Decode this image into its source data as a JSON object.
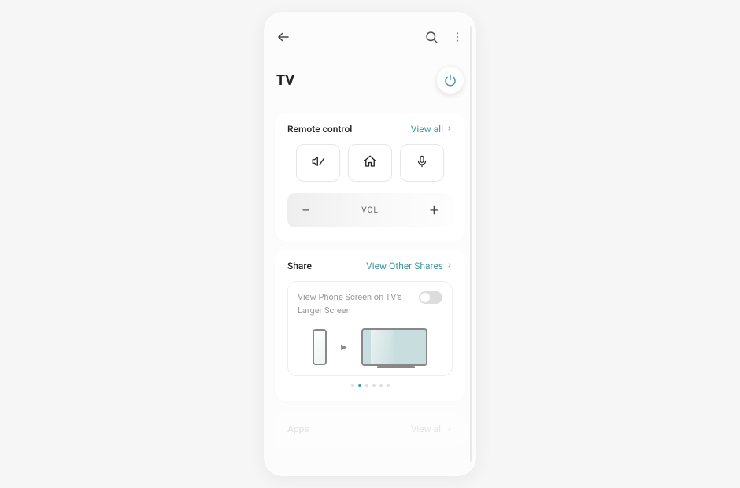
{
  "header": {
    "title": "TV"
  },
  "remote": {
    "title": "Remote control",
    "view_all": "View all",
    "vol_label": "VOL"
  },
  "share": {
    "title": "Share",
    "view_others": "View Other Shares",
    "cast_text": "View Phone Screen on TV's Larger Screen"
  },
  "apps": {
    "title": "Apps",
    "view_all": "View all"
  },
  "colors": {
    "accent": "#3a9b9b"
  },
  "pagination": {
    "total": 6,
    "active_index": 1
  }
}
